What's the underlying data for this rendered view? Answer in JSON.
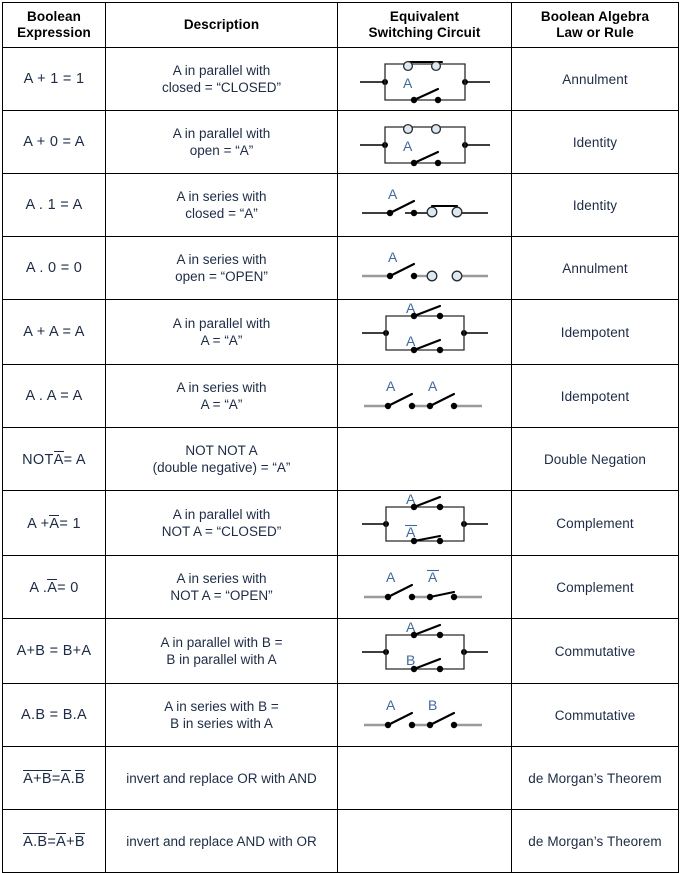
{
  "table": {
    "headers": [
      {
        "line1": "Boolean",
        "line2": "Expression"
      },
      {
        "line1": "Description",
        "line2": ""
      },
      {
        "line1": "Equivalent",
        "line2": "Switching Circuit"
      },
      {
        "line1": "Boolean Algebra",
        "line2": "Law or Rule"
      }
    ],
    "rows": [
      {
        "expression_text": "A + 1 = 1",
        "description_line1": "A in parallel with",
        "description_line2": "closed = “CLOSED”",
        "circuit": "parallel-A-closed",
        "law": "Annulment"
      },
      {
        "expression_text": "A + 0 = A",
        "description_line1": "A in parallel with",
        "description_line2": "open = “A”",
        "circuit": "parallel-A-open",
        "law": "Identity"
      },
      {
        "expression_text": "A . 1 = A",
        "description_line1": "A in series with",
        "description_line2": "closed = “A”",
        "circuit": "series-A-closed",
        "law": "Identity"
      },
      {
        "expression_text": "A . 0 = 0",
        "description_line1": "A in series with",
        "description_line2": "open = “OPEN”",
        "circuit": "series-A-open",
        "law": "Annulment"
      },
      {
        "expression_text": "A + A = A",
        "description_line1": "A in parallel with",
        "description_line2": "A = “A”",
        "circuit": "parallel-A-A",
        "law": "Idempotent"
      },
      {
        "expression_text": "A . A = A",
        "description_line1": "A in series with",
        "description_line2": "A = “A”",
        "circuit": "series-A-A",
        "law": "Idempotent"
      },
      {
        "expression_text": "NOT A̅ = A",
        "description_line1": "NOT NOT A",
        "description_line2": "(double negative) = “A”",
        "circuit": "none",
        "law": "Double Negation"
      },
      {
        "expression_text": "A + A̅ = 1",
        "description_line1": "A in parallel with",
        "description_line2": "NOT A = “CLOSED”",
        "circuit": "parallel-A-notA",
        "law": "Complement"
      },
      {
        "expression_text": "A . A̅ = 0",
        "description_line1": "A in series with",
        "description_line2": "NOT A = “OPEN”",
        "circuit": "series-A-notA",
        "law": "Complement"
      },
      {
        "expression_text": "A+B = B+A",
        "description_line1": "A in parallel with B =",
        "description_line2": "B in parallel with A",
        "circuit": "parallel-A-B",
        "law": "Commutative"
      },
      {
        "expression_text": "A.B = B.A",
        "description_line1": "A in series with B =",
        "description_line2": "B in series with A",
        "circuit": "series-A-B",
        "law": "Commutative"
      },
      {
        "expression_text": "A+B̅ = A̅.B̅",
        "description_line1": "invert and replace OR with AND",
        "description_line2": "",
        "circuit": "none",
        "law": "de Morgan’s Theorem"
      },
      {
        "expression_text": "A.B̅ = A̅+B̅",
        "description_line1": "invert and replace AND with OR",
        "description_line2": "",
        "circuit": "none",
        "law": "de Morgan’s Theorem"
      }
    ]
  },
  "expressions": {
    "r7": {
      "prefix": "NOT ",
      "bar": "A",
      "suffix": " = A"
    },
    "r8": {
      "lead": "A + ",
      "bar": "A",
      "suffix": " = 1"
    },
    "r9": {
      "lead": "A . ",
      "bar": "A",
      "suffix": " = 0"
    },
    "r12": {
      "barleft": "A+B",
      "eq": " = ",
      "bar1": "A",
      "dot": ".",
      "bar2": "B"
    },
    "r13": {
      "barleft": "A.B",
      "eq": " = ",
      "bar1": "A",
      "plus": "+",
      "bar2": "B"
    }
  },
  "circuit_labels": {
    "A": "A",
    "B": "B",
    "notA": "A"
  },
  "colors": {
    "border": "#000000",
    "text": "#1c2b4a",
    "header_text": "#000000",
    "circuit_label": "#3c6aa8",
    "wire": "#3f3f3f",
    "contact_open": "#dce9f2"
  }
}
